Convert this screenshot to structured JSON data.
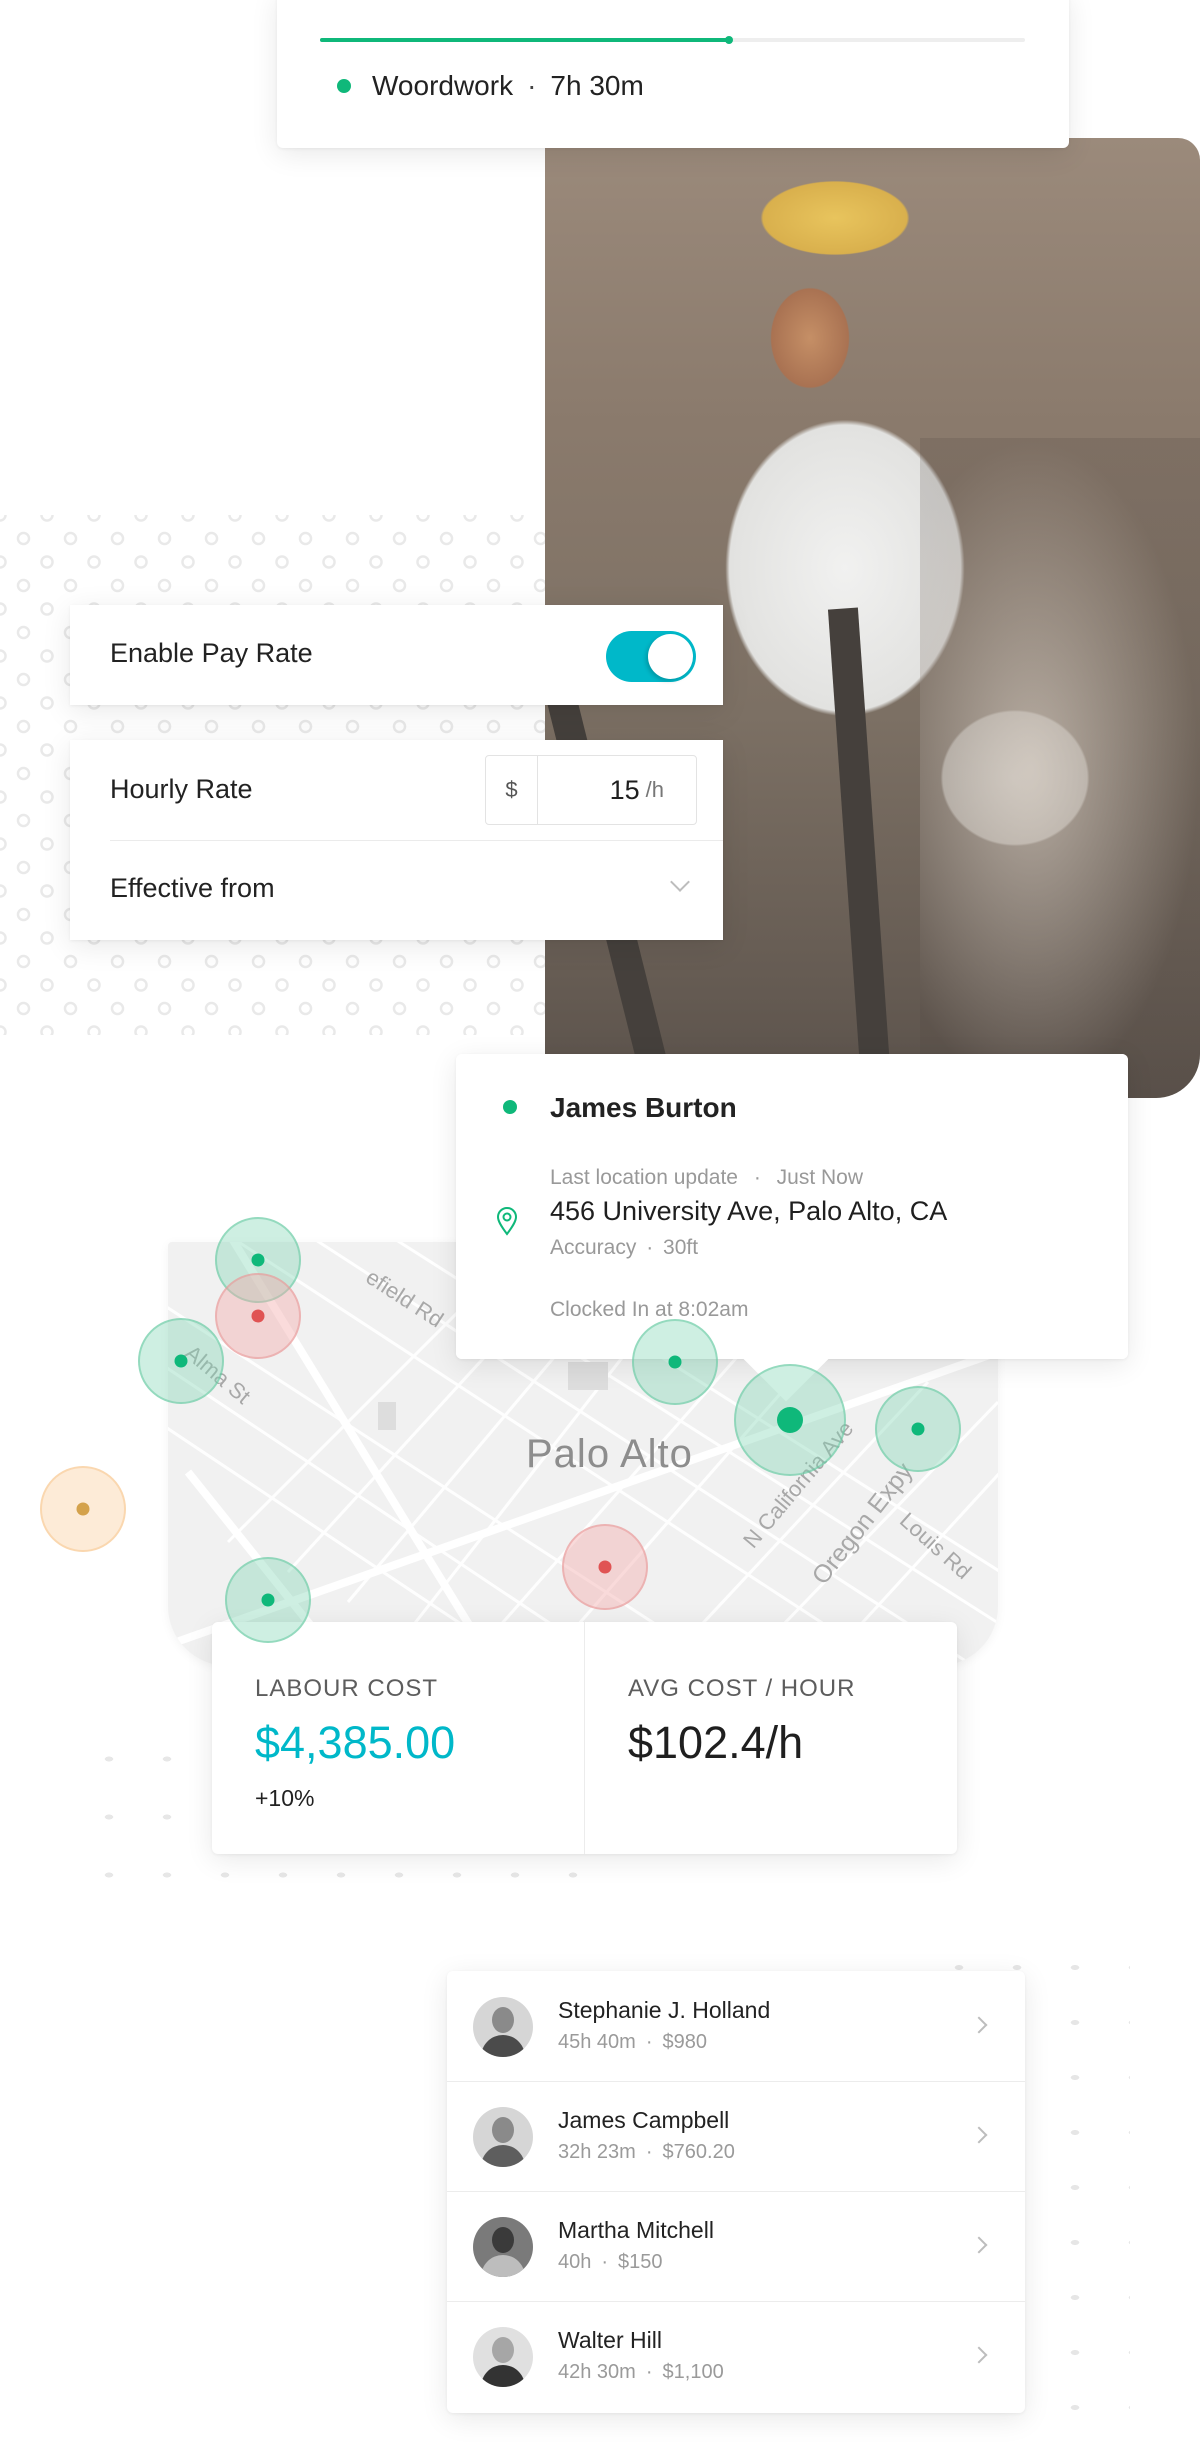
{
  "activity": {
    "progress_percent": 58,
    "label": "Woordwork",
    "duration": "7h 30m",
    "status_color": "#0fb87a"
  },
  "pay_rate": {
    "enable_label": "Enable Pay Rate",
    "enabled": true,
    "hourly_label": "Hourly Rate",
    "currency_symbol": "$",
    "hourly_value": "15",
    "unit": "/h",
    "effective_label": "Effective from",
    "toggle_color": "#00b8c9"
  },
  "location": {
    "name": "James Burton",
    "last_update_label": "Last location update",
    "last_update_value": "Just Now",
    "address": "456 University Ave, Palo Alto, CA",
    "accuracy_label": "Accuracy",
    "accuracy_value": "30ft",
    "clocked_in": "Clocked In at 8:02am",
    "status_color": "#0fb87a"
  },
  "map": {
    "city": "Palo Alto",
    "streets": [
      "Alma St",
      "Middlefield Rd",
      "N California Ave",
      "Oregon Expy",
      "Louis Rd"
    ],
    "street_visible": {
      "middlefield": "efield Rd",
      "alma": "Alma St",
      "california": "N California Ave",
      "oregon": "Oregon Expy",
      "louis": "Louis Rd"
    },
    "markers": [
      {
        "status": "active",
        "color": "green"
      },
      {
        "status": "inactive",
        "color": "red"
      },
      {
        "status": "active",
        "color": "green"
      },
      {
        "status": "active",
        "color": "green"
      },
      {
        "status": "selected",
        "color": "green"
      },
      {
        "status": "active",
        "color": "green"
      },
      {
        "status": "inactive",
        "color": "red"
      },
      {
        "status": "active",
        "color": "green"
      },
      {
        "status": "pending",
        "color": "orange"
      }
    ]
  },
  "stats": {
    "labour_cost_title": "LABOUR COST",
    "labour_cost_value": "$4,385.00",
    "labour_cost_delta": "+10%",
    "avg_cost_title": "AVG COST / HOUR",
    "avg_cost_value": "$102.4/h",
    "accent_color": "#00b8c9"
  },
  "employees": [
    {
      "name": "Stephanie J. Holland",
      "hours": "45h 40m",
      "amount": "$980"
    },
    {
      "name": "James Campbell",
      "hours": "32h 23m",
      "amount": "$760.20"
    },
    {
      "name": "Martha Mitchell",
      "hours": "40h",
      "amount": "$150"
    },
    {
      "name": "Walter Hill",
      "hours": "42h 30m",
      "amount": "$1,100"
    }
  ],
  "separator": "·"
}
